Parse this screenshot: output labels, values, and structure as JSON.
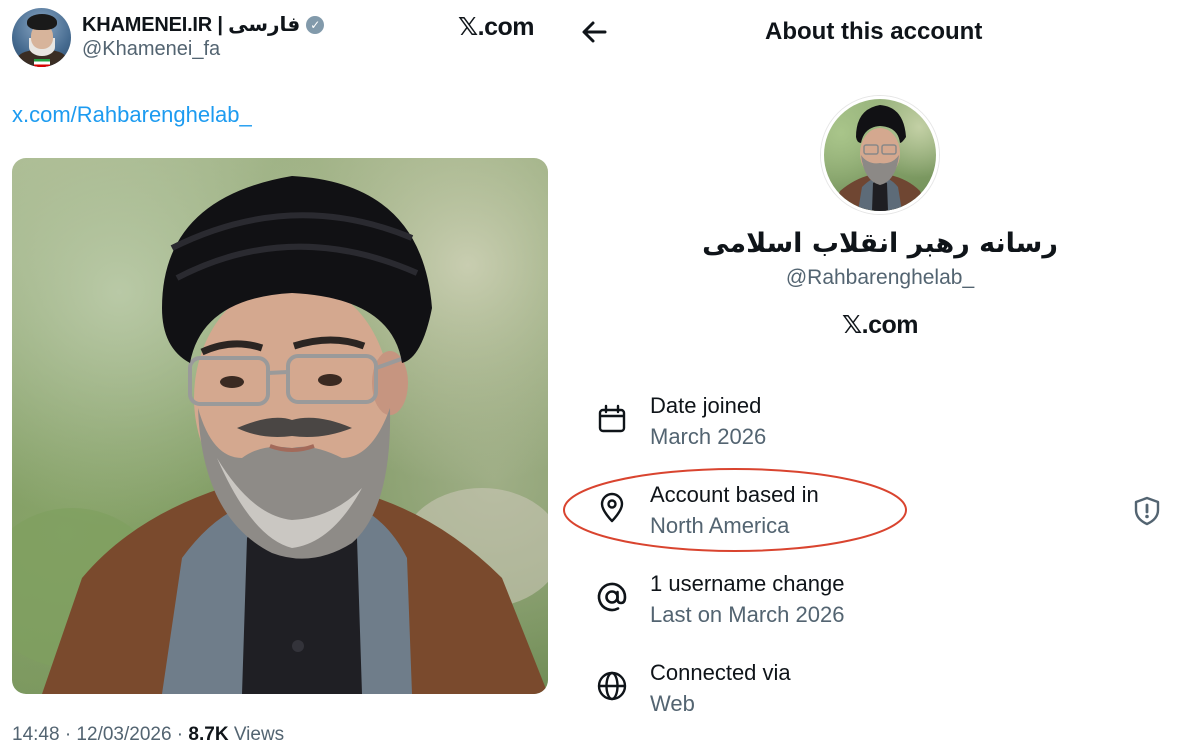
{
  "tweet": {
    "author_name": "KHAMENEI.IR | فارسی",
    "author_handle": "@Khamenei_fa",
    "verified_icon": "verified-badge-icon",
    "site_logo": "𝕏.com",
    "link_text": "x.com/Rahbarenghelab_",
    "time": "14:48 · 12/03/2026 · ",
    "views_count": "8.7K",
    "views_label": " Views"
  },
  "about": {
    "title": "About this account",
    "display_name": "رسانه رهبر انقلاب اسلامی",
    "handle": "@Rahbarenghelab_",
    "site_logo": "𝕏.com",
    "rows": [
      {
        "icon": "calendar-icon",
        "label": "Date joined",
        "value": "March 2026"
      },
      {
        "icon": "location-pin-icon",
        "label": "Account based in",
        "value": "North America"
      },
      {
        "icon": "at-sign-icon",
        "label": "1 username change",
        "value": "Last on March 2026"
      },
      {
        "icon": "globe-icon",
        "label": "Connected via",
        "value": "Web"
      }
    ]
  },
  "colors": {
    "link": "#1d9bf0",
    "secondary_text": "#536471",
    "annotation": "#d9442f",
    "verified": "#829aab"
  }
}
